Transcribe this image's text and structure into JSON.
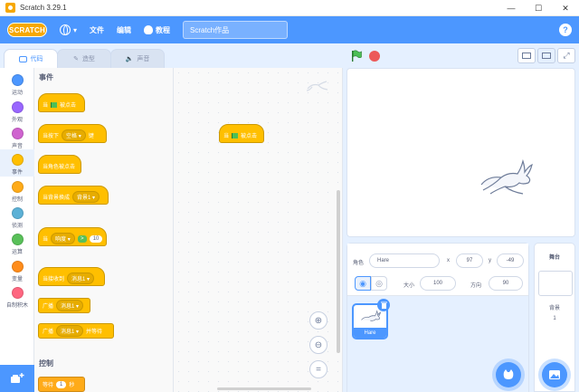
{
  "window": {
    "title": "Scratch 3.29.1"
  },
  "menubar": {
    "logo": "SCRATCH",
    "file": "文件",
    "edit": "编辑",
    "tutorials": "教程",
    "project_name": "Scratch作品",
    "help": "?"
  },
  "tabs": {
    "code": "代码",
    "costumes": "造型",
    "sounds": "声音"
  },
  "categories": [
    {
      "label": "运动",
      "color": "#4c97ff"
    },
    {
      "label": "外观",
      "color": "#9966ff"
    },
    {
      "label": "声音",
      "color": "#cf63cf"
    },
    {
      "label": "事件",
      "color": "#ffbf00"
    },
    {
      "label": "控制",
      "color": "#ffab19"
    },
    {
      "label": "侦测",
      "color": "#5cb1d6"
    },
    {
      "label": "运算",
      "color": "#59c059"
    },
    {
      "label": "变量",
      "color": "#ff8c1a"
    },
    {
      "label": "自制积木",
      "color": "#ff6680"
    }
  ],
  "palette": {
    "events_title": "事件",
    "control_title": "控制",
    "when_flag_a": "当",
    "when_flag_b": "被点击",
    "when_key_a": "当按下",
    "when_key_key": "空格",
    "when_key_b": "键",
    "when_sprite_clicked": "当角色被点击",
    "when_backdrop": "当背景换成",
    "backdrop_value": "背景1",
    "when_gt_a": "当",
    "when_gt_sensor": "响度",
    "when_gt_symbol": ">",
    "when_gt_value": "10",
    "when_receive": "当接收到",
    "message_value": "消息1",
    "broadcast": "广播",
    "broadcast_message": "消息1",
    "broadcast_wait": "广播",
    "broadcast_wait_message": "消息1",
    "broadcast_wait_suffix": "并等待",
    "wait_a": "等待",
    "wait_value": "1",
    "wait_b": "秒"
  },
  "script": {
    "hat_a": "当",
    "hat_b": "被点击"
  },
  "sprite_info": {
    "sprite_label": "角色",
    "sprite_name": "Hare",
    "x_label": "x",
    "x_value": "97",
    "y_label": "y",
    "y_value": "-49",
    "size_label": "大小",
    "size_value": "100",
    "direction_label": "方向",
    "direction_value": "90"
  },
  "sprites": [
    {
      "name": "Hare"
    }
  ],
  "stage_pane": {
    "title": "舞台",
    "backdrops_label": "背景",
    "backdrops_count": "1"
  },
  "colors": {
    "accent": "#4c97ff",
    "events": "#ffbf00",
    "flag": "#4cbf56",
    "stop": "#ec5959"
  }
}
